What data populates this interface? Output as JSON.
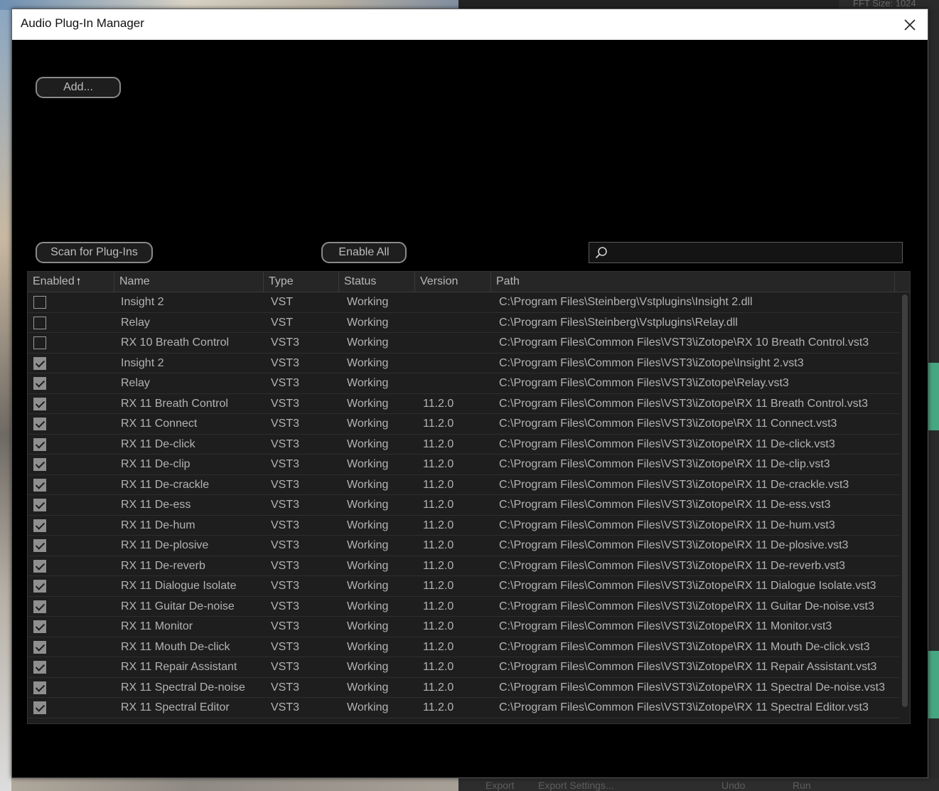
{
  "dialog": {
    "title": "Audio Plug-In Manager",
    "close_glyph": "✕"
  },
  "buttons": {
    "add": "Add...",
    "scan": "Scan for Plug-Ins",
    "enable_all": "Enable All"
  },
  "search": {
    "placeholder": "",
    "value": "",
    "icon": "search-icon"
  },
  "table": {
    "columns": [
      "Enabled",
      "Name",
      "Type",
      "Status",
      "Version",
      "Path"
    ],
    "sort_column": "Enabled",
    "sort_indicator": "🠕",
    "rows": [
      {
        "enabled": false,
        "name": "Insight 2",
        "type": "VST",
        "status": "Working",
        "version": "",
        "path": "C:\\Program Files\\Steinberg\\Vstplugins\\Insight 2.dll"
      },
      {
        "enabled": false,
        "name": "Relay",
        "type": "VST",
        "status": "Working",
        "version": "",
        "path": "C:\\Program Files\\Steinberg\\Vstplugins\\Relay.dll"
      },
      {
        "enabled": false,
        "name": "RX 10 Breath Control",
        "type": "VST3",
        "status": "Working",
        "version": "",
        "path": "C:\\Program Files\\Common Files\\VST3\\iZotope\\RX 10 Breath Control.vst3"
      },
      {
        "enabled": true,
        "name": "Insight 2",
        "type": "VST3",
        "status": "Working",
        "version": "",
        "path": "C:\\Program Files\\Common Files\\VST3\\iZotope\\Insight 2.vst3"
      },
      {
        "enabled": true,
        "name": "Relay",
        "type": "VST3",
        "status": "Working",
        "version": "",
        "path": "C:\\Program Files\\Common Files\\VST3\\iZotope\\Relay.vst3"
      },
      {
        "enabled": true,
        "name": "RX 11 Breath Control",
        "type": "VST3",
        "status": "Working",
        "version": "11.2.0",
        "path": "C:\\Program Files\\Common Files\\VST3\\iZotope\\RX 11 Breath Control.vst3"
      },
      {
        "enabled": true,
        "name": "RX 11 Connect",
        "type": "VST3",
        "status": "Working",
        "version": "11.2.0",
        "path": "C:\\Program Files\\Common Files\\VST3\\iZotope\\RX 11 Connect.vst3"
      },
      {
        "enabled": true,
        "name": "RX 11 De-click",
        "type": "VST3",
        "status": "Working",
        "version": "11.2.0",
        "path": "C:\\Program Files\\Common Files\\VST3\\iZotope\\RX 11 De-click.vst3"
      },
      {
        "enabled": true,
        "name": "RX 11 De-clip",
        "type": "VST3",
        "status": "Working",
        "version": "11.2.0",
        "path": "C:\\Program Files\\Common Files\\VST3\\iZotope\\RX 11 De-clip.vst3"
      },
      {
        "enabled": true,
        "name": "RX 11 De-crackle",
        "type": "VST3",
        "status": "Working",
        "version": "11.2.0",
        "path": "C:\\Program Files\\Common Files\\VST3\\iZotope\\RX 11 De-crackle.vst3"
      },
      {
        "enabled": true,
        "name": "RX 11 De-ess",
        "type": "VST3",
        "status": "Working",
        "version": "11.2.0",
        "path": "C:\\Program Files\\Common Files\\VST3\\iZotope\\RX 11 De-ess.vst3"
      },
      {
        "enabled": true,
        "name": "RX 11 De-hum",
        "type": "VST3",
        "status": "Working",
        "version": "11.2.0",
        "path": "C:\\Program Files\\Common Files\\VST3\\iZotope\\RX 11 De-hum.vst3"
      },
      {
        "enabled": true,
        "name": "RX 11 De-plosive",
        "type": "VST3",
        "status": "Working",
        "version": "11.2.0",
        "path": "C:\\Program Files\\Common Files\\VST3\\iZotope\\RX 11 De-plosive.vst3"
      },
      {
        "enabled": true,
        "name": "RX 11 De-reverb",
        "type": "VST3",
        "status": "Working",
        "version": "11.2.0",
        "path": "C:\\Program Files\\Common Files\\VST3\\iZotope\\RX 11 De-reverb.vst3"
      },
      {
        "enabled": true,
        "name": "RX 11 Dialogue Isolate",
        "type": "VST3",
        "status": "Working",
        "version": "11.2.0",
        "path": "C:\\Program Files\\Common Files\\VST3\\iZotope\\RX 11 Dialogue Isolate.vst3"
      },
      {
        "enabled": true,
        "name": "RX 11 Guitar De-noise",
        "type": "VST3",
        "status": "Working",
        "version": "11.2.0",
        "path": "C:\\Program Files\\Common Files\\VST3\\iZotope\\RX 11 Guitar De-noise.vst3"
      },
      {
        "enabled": true,
        "name": "RX 11 Monitor",
        "type": "VST3",
        "status": "Working",
        "version": "11.2.0",
        "path": "C:\\Program Files\\Common Files\\VST3\\iZotope\\RX 11 Monitor.vst3"
      },
      {
        "enabled": true,
        "name": "RX 11 Mouth De-click",
        "type": "VST3",
        "status": "Working",
        "version": "11.2.0",
        "path": "C:\\Program Files\\Common Files\\VST3\\iZotope\\RX 11 Mouth De-click.vst3"
      },
      {
        "enabled": true,
        "name": "RX 11 Repair Assistant",
        "type": "VST3",
        "status": "Working",
        "version": "11.2.0",
        "path": "C:\\Program Files\\Common Files\\VST3\\iZotope\\RX 11 Repair Assistant.vst3"
      },
      {
        "enabled": true,
        "name": "RX 11 Spectral De-noise",
        "type": "VST3",
        "status": "Working",
        "version": "11.2.0",
        "path": "C:\\Program Files\\Common Files\\VST3\\iZotope\\RX 11 Spectral De-noise.vst3"
      },
      {
        "enabled": true,
        "name": "RX 11 Spectral Editor",
        "type": "VST3",
        "status": "Working",
        "version": "11.2.0",
        "path": "C:\\Program Files\\Common Files\\VST3\\iZotope\\RX 11 Spectral Editor.vst3"
      }
    ]
  },
  "background_app": {
    "top_label": "FFT Size:  1024",
    "bottom_labels": [
      "Export",
      "Export Settings...",
      "Undo",
      "Run"
    ]
  },
  "colors": {
    "dialog_bg": "#000000",
    "table_bg": "#1e1e1e",
    "accent_wave": "#4fc79a"
  }
}
